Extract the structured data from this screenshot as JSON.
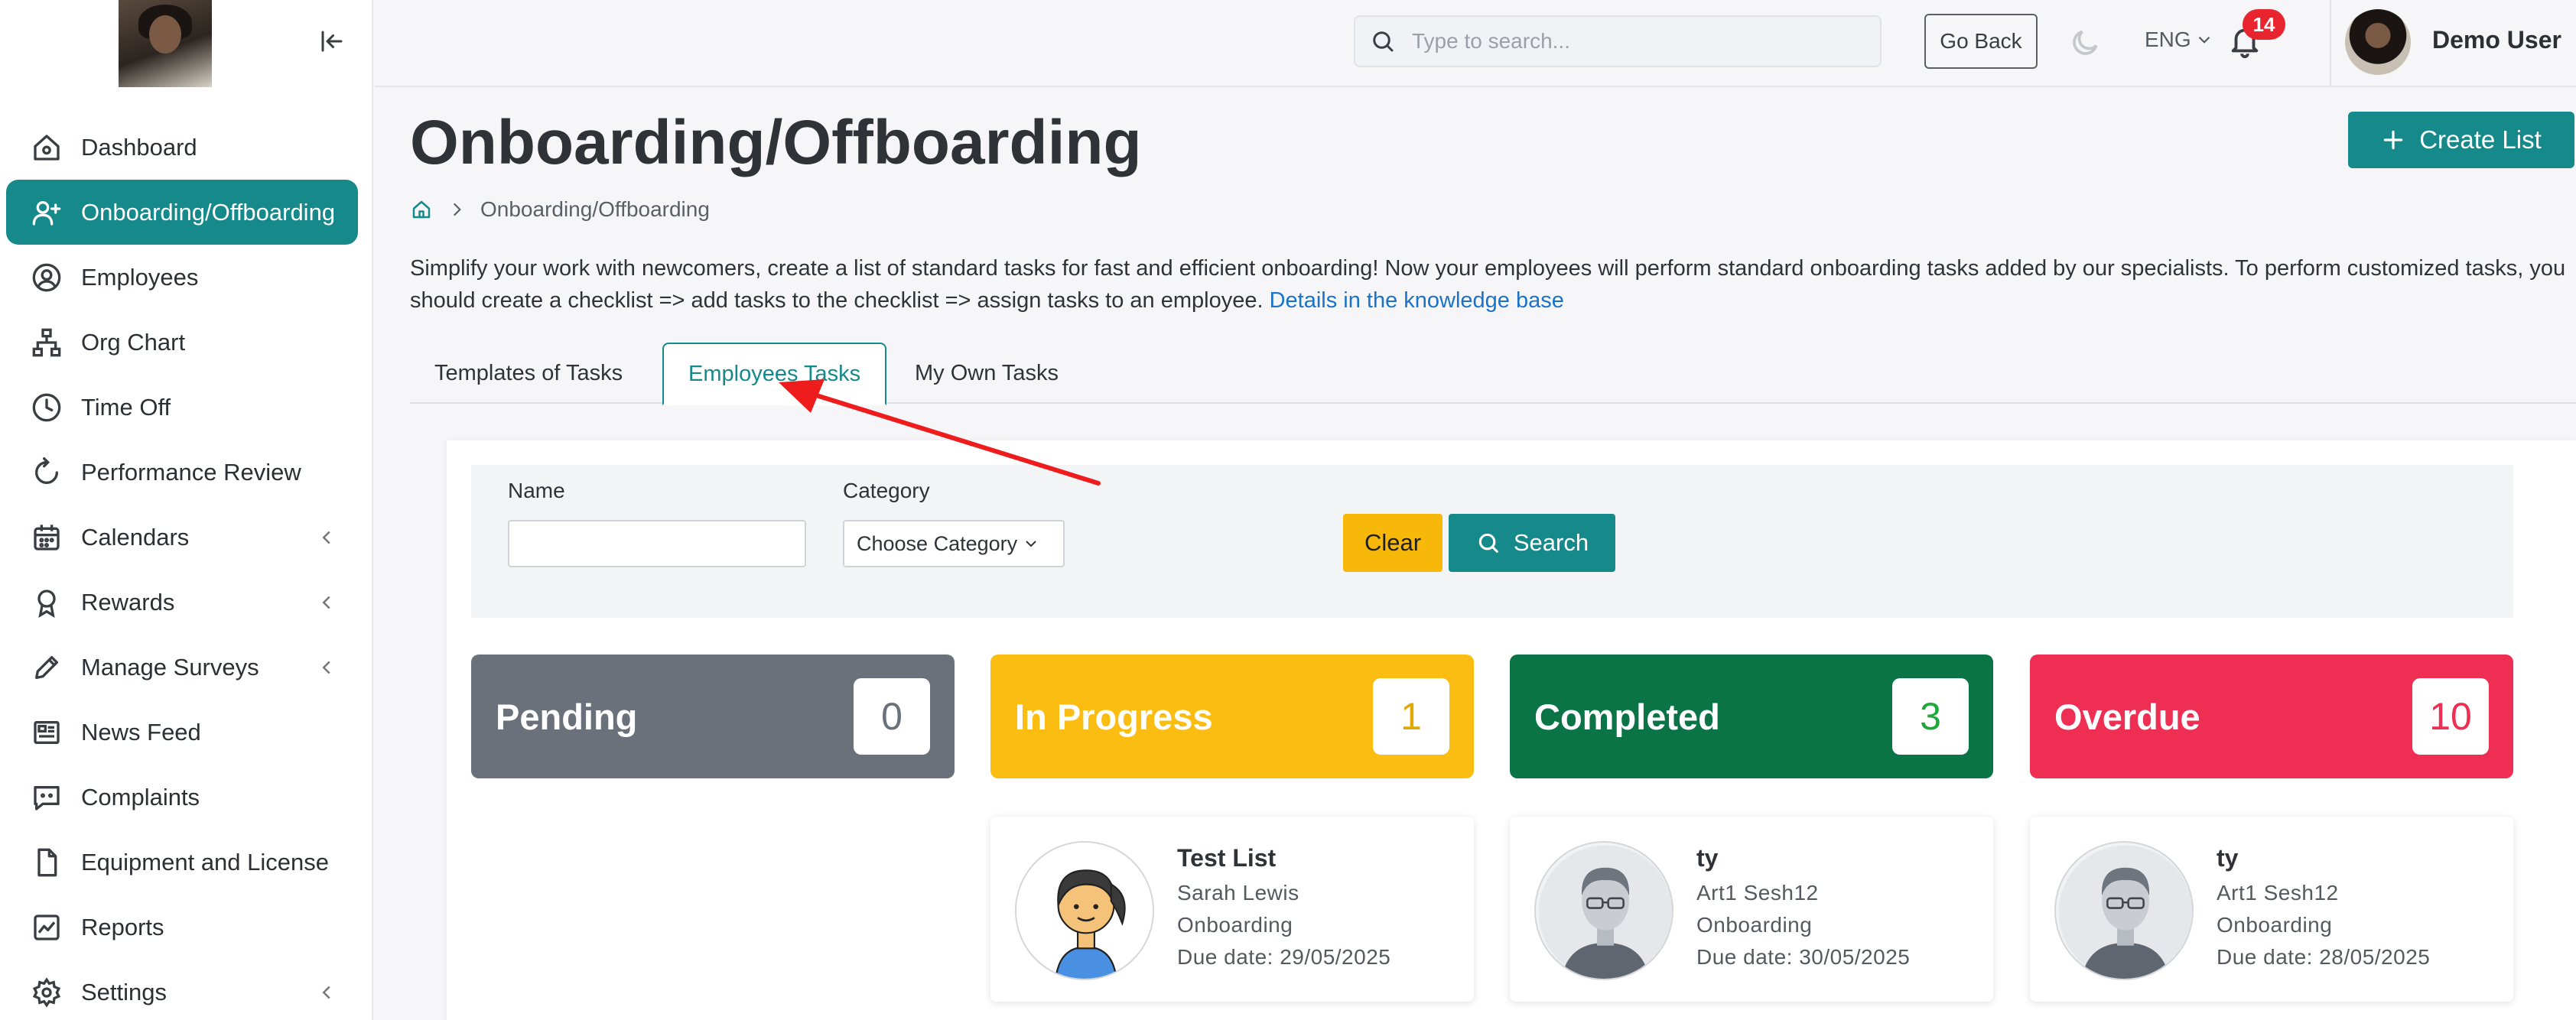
{
  "sidebar": {
    "items": [
      {
        "label": "Dashboard",
        "icon": "home-icon",
        "active": false,
        "has_chevron": false
      },
      {
        "label": "Onboarding/Offboarding",
        "icon": "user-plus-icon",
        "active": true,
        "has_chevron": false
      },
      {
        "label": "Employees",
        "icon": "user-circle-icon",
        "active": false,
        "has_chevron": false
      },
      {
        "label": "Org Chart",
        "icon": "org-chart-icon",
        "active": false,
        "has_chevron": false
      },
      {
        "label": "Time Off",
        "icon": "clock-icon",
        "active": false,
        "has_chevron": false
      },
      {
        "label": "Performance Review",
        "icon": "refresh-icon",
        "active": false,
        "has_chevron": false
      },
      {
        "label": "Calendars",
        "icon": "calendar-icon",
        "active": false,
        "has_chevron": true
      },
      {
        "label": "Rewards",
        "icon": "award-icon",
        "active": false,
        "has_chevron": true
      },
      {
        "label": "Manage Surveys",
        "icon": "pen-icon",
        "active": false,
        "has_chevron": true
      },
      {
        "label": "News Feed",
        "icon": "newspaper-icon",
        "active": false,
        "has_chevron": false
      },
      {
        "label": "Complaints",
        "icon": "chat-icon",
        "active": false,
        "has_chevron": false
      },
      {
        "label": "Equipment and License",
        "icon": "document-icon",
        "active": false,
        "has_chevron": false
      },
      {
        "label": "Reports",
        "icon": "chart-line-icon",
        "active": false,
        "has_chevron": false
      },
      {
        "label": "Settings",
        "icon": "gear-icon",
        "active": false,
        "has_chevron": true
      }
    ]
  },
  "topbar": {
    "search_placeholder": "Type to search...",
    "go_back": "Go Back",
    "language": "ENG",
    "notification_count": "14",
    "user_name": "Demo User"
  },
  "page": {
    "title": "Onboarding/Offboarding",
    "create_button": "Create List",
    "breadcrumb": "Onboarding/Offboarding",
    "description": "Simplify your work with newcomers, create a list of standard tasks for fast and efficient onboarding! Now your employees will perform standard onboarding tasks added by our specialists. To perform customized tasks, you should create a checklist => add tasks to the checklist => assign tasks to an employee.",
    "description_link": "Details in the knowledge base"
  },
  "tabs": [
    {
      "label": "Templates of Tasks",
      "active": false
    },
    {
      "label": "Employees Tasks",
      "active": true
    },
    {
      "label": "My Own Tasks",
      "active": false
    }
  ],
  "filter": {
    "name_label": "Name",
    "name_value": "",
    "category_label": "Category",
    "category_value": "Choose Category",
    "clear_button": "Clear",
    "search_button": "Search"
  },
  "status_boxes": [
    {
      "label": "Pending",
      "count": "0",
      "color": "#6b717b",
      "count_color": "#6b717b"
    },
    {
      "label": "In Progress",
      "count": "1",
      "color": "#fbbd12",
      "count_color": "#e0a800"
    },
    {
      "label": "Completed",
      "count": "3",
      "color": "#0b7447",
      "count_color": "#1ea83c"
    },
    {
      "label": "Overdue",
      "count": "10",
      "color": "#ee2e52",
      "count_color": "#ee2e52"
    }
  ],
  "task_cards": [
    {
      "title": "Test List",
      "person": "Sarah Lewis",
      "type": "Onboarding",
      "due": "Due date: 29/05/2025",
      "avatar": "female-avatar-icon"
    },
    {
      "title": "ty",
      "person": "Art1 Sesh12",
      "type": "Onboarding",
      "due": "Due date: 30/05/2025",
      "avatar": "male-avatar-icon"
    },
    {
      "title": "ty",
      "person": "Art1 Sesh12",
      "type": "Onboarding",
      "due": "Due date: 28/05/2025",
      "avatar": "male-avatar-icon"
    }
  ],
  "colors": {
    "accent": "#16898a",
    "link": "#1a73c9",
    "annotation_arrow": "#ee1c1c"
  }
}
